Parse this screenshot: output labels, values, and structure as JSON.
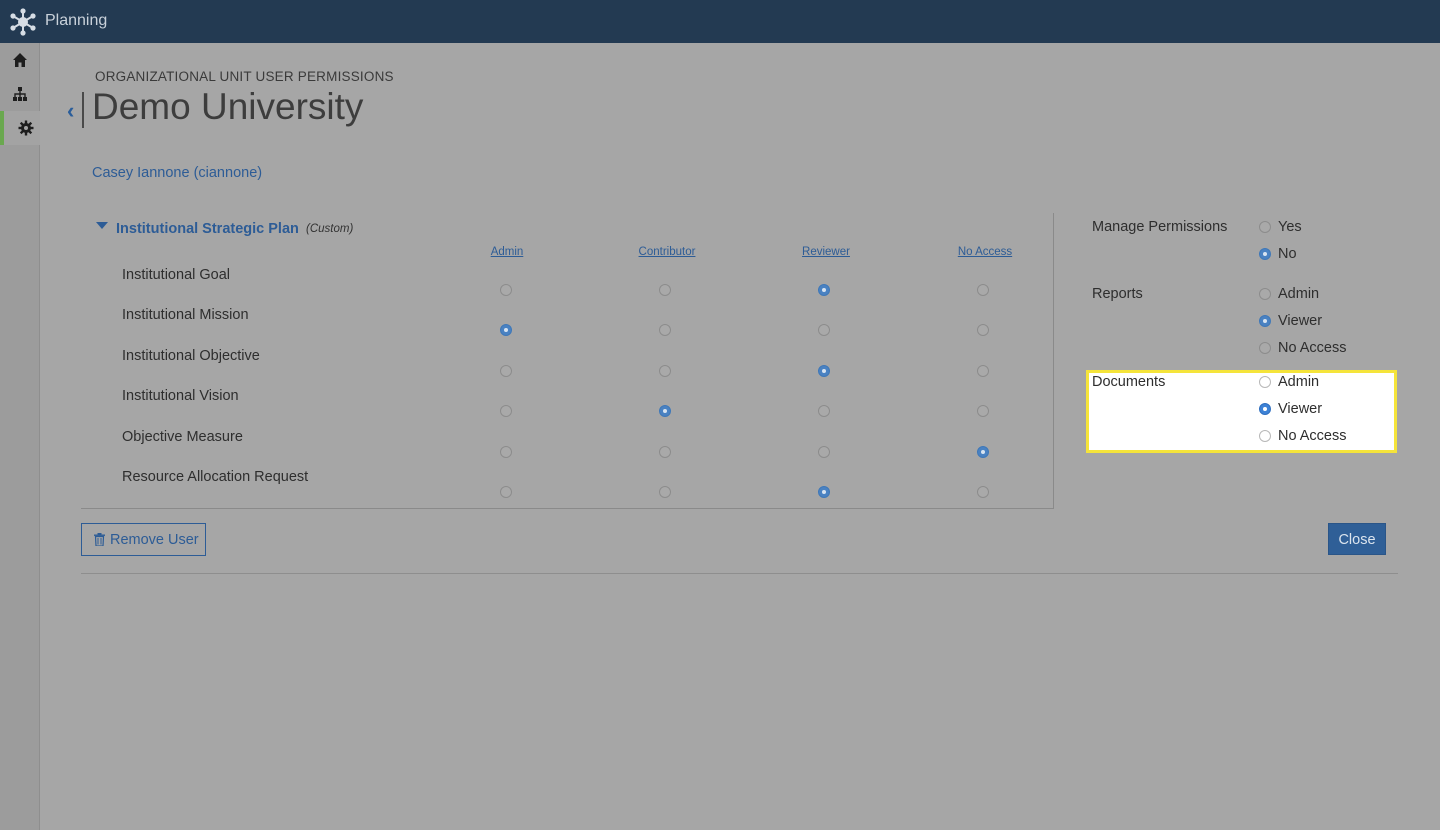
{
  "app": {
    "title": "Planning"
  },
  "sidebar": {
    "items": [
      {
        "icon": "home-icon"
      },
      {
        "icon": "org-chart-icon"
      },
      {
        "icon": "gear-icon",
        "active": true
      }
    ]
  },
  "header": {
    "subtitle": "ORGANIZATIONAL UNIT USER PERMISSIONS",
    "title": "Demo University"
  },
  "user": {
    "name": "Casey Iannone (ciannone)"
  },
  "plan": {
    "name": "Institutional Strategic Plan",
    "tag": "(Custom)",
    "columns": [
      "Admin",
      "Contributor",
      "Reviewer",
      "No Access"
    ],
    "rows": [
      {
        "label": "Institutional Goal",
        "selected": 2
      },
      {
        "label": "Institutional Mission",
        "selected": 0
      },
      {
        "label": "Institutional Objective",
        "selected": 2
      },
      {
        "label": "Institutional Vision",
        "selected": 1
      },
      {
        "label": "Objective Measure",
        "selected": 3
      },
      {
        "label": "Resource Allocation Request",
        "selected": 2
      }
    ]
  },
  "settings": {
    "manage_permissions": {
      "label": "Manage Permissions",
      "options": [
        "Yes",
        "No"
      ],
      "selected": 1
    },
    "reports": {
      "label": "Reports",
      "options": [
        "Admin",
        "Viewer",
        "No Access"
      ],
      "selected": 1
    },
    "documents": {
      "label": "Documents",
      "options": [
        "Admin",
        "Viewer",
        "No Access"
      ],
      "selected": 1,
      "highlight_color": "#f5e43a"
    }
  },
  "actions": {
    "remove_label": "Remove User",
    "close_label": "Close"
  },
  "colors": {
    "topbar": "#233a52",
    "accent": "#2d5c96",
    "active_marker": "#6aa84f"
  }
}
